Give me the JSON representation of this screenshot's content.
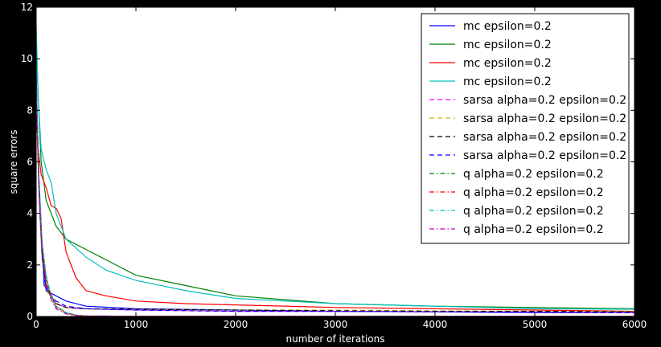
{
  "chart_data": {
    "type": "line",
    "title": "",
    "xlabel": "number of iterations",
    "ylabel": "square errors",
    "xlim": [
      0,
      6000
    ],
    "ylim": [
      0,
      12
    ],
    "xticks": [
      0,
      1000,
      2000,
      3000,
      4000,
      5000,
      6000
    ],
    "yticks": [
      0,
      2,
      4,
      6,
      8,
      10,
      12
    ],
    "grid": false,
    "legend_position": "top-right",
    "series": [
      {
        "name": "mc epsilon=0.2",
        "color": "#0000ff",
        "style": "solid",
        "x": [
          0,
          20,
          50,
          80,
          150,
          300,
          500,
          1000,
          2000,
          3000,
          4000,
          5000,
          6000
        ],
        "y": [
          9.5,
          6.0,
          3.5,
          1.2,
          0.9,
          0.6,
          0.4,
          0.3,
          0.25,
          0.2,
          0.18,
          0.15,
          0.15
        ]
      },
      {
        "name": "mc epsilon=0.2",
        "color": "#008000",
        "style": "solid",
        "x": [
          0,
          20,
          50,
          100,
          200,
          300,
          500,
          700,
          1000,
          1500,
          2000,
          3000,
          4000,
          5000,
          6000
        ],
        "y": [
          10.5,
          8.5,
          6.0,
          4.5,
          3.5,
          3.0,
          2.6,
          2.2,
          1.6,
          1.2,
          0.8,
          0.5,
          0.4,
          0.35,
          0.3
        ]
      },
      {
        "name": "mc epsilon=0.2",
        "color": "#ff0000",
        "style": "solid",
        "x": [
          0,
          20,
          50,
          100,
          150,
          200,
          250,
          300,
          400,
          500,
          700,
          1000,
          1500,
          2000,
          3000,
          4000,
          5000,
          6000
        ],
        "y": [
          9.0,
          6.5,
          5.5,
          5.0,
          4.3,
          4.2,
          3.8,
          2.5,
          1.5,
          1.0,
          0.8,
          0.6,
          0.5,
          0.45,
          0.35,
          0.3,
          0.25,
          0.2
        ]
      },
      {
        "name": "mc epsilon=0.2",
        "color": "#00bfbf",
        "style": "solid",
        "x": [
          0,
          20,
          50,
          100,
          150,
          200,
          300,
          500,
          700,
          1000,
          1500,
          2000,
          3000,
          4000,
          5000,
          6000
        ],
        "y": [
          11.3,
          8.5,
          6.5,
          5.7,
          5.2,
          4.0,
          3.0,
          2.3,
          1.8,
          1.4,
          1.0,
          0.7,
          0.5,
          0.4,
          0.3,
          0.28
        ]
      },
      {
        "name": "sarsa alpha=0.2 epsilon=0.2",
        "color": "#ff00ff",
        "style": "dashed",
        "x": [
          0,
          30,
          60,
          100,
          200,
          300,
          500,
          1000,
          2000,
          3000,
          4000,
          5000,
          6000
        ],
        "y": [
          9.0,
          5.0,
          2.5,
          1.2,
          0.5,
          0.35,
          0.3,
          0.25,
          0.2,
          0.2,
          0.18,
          0.18,
          0.15
        ]
      },
      {
        "name": "sarsa alpha=0.2 epsilon=0.2",
        "color": "#bfbf00",
        "style": "dashed",
        "x": [
          0,
          30,
          60,
          100,
          200,
          300,
          500,
          1000,
          2000,
          3000,
          4000,
          5000,
          6000
        ],
        "y": [
          8.5,
          4.5,
          2.2,
          1.0,
          0.5,
          0.35,
          0.3,
          0.28,
          0.25,
          0.25,
          0.22,
          0.2,
          0.2
        ]
      },
      {
        "name": "sarsa alpha=0.2 epsilon=0.2",
        "color": "#000000",
        "style": "dashed",
        "x": [
          0,
          30,
          60,
          100,
          200,
          300,
          500,
          1000,
          2000,
          3000,
          4000,
          5000,
          6000
        ],
        "y": [
          8.8,
          4.8,
          2.4,
          1.1,
          0.5,
          0.35,
          0.3,
          0.28,
          0.25,
          0.22,
          0.2,
          0.2,
          0.18
        ]
      },
      {
        "name": "sarsa alpha=0.2 epsilon=0.2",
        "color": "#0000ff",
        "style": "dashed",
        "x": [
          0,
          30,
          60,
          100,
          200,
          300,
          500,
          1000,
          2000,
          3000,
          4000,
          5000,
          6000
        ],
        "y": [
          8.6,
          4.6,
          2.3,
          1.0,
          0.6,
          0.4,
          0.3,
          0.25,
          0.2,
          0.2,
          0.18,
          0.16,
          0.15
        ]
      },
      {
        "name": "q alpha=0.2 epsilon=0.2",
        "color": "#008000",
        "style": "dashdot",
        "x": [
          0,
          30,
          60,
          100,
          150,
          200,
          300,
          400,
          500,
          1000,
          2000,
          3000,
          4000,
          5000,
          6000
        ],
        "y": [
          9.0,
          5.0,
          2.8,
          1.5,
          0.8,
          0.4,
          0.15,
          0.05,
          0.02,
          0.01,
          0.01,
          0.01,
          0.01,
          0.01,
          0.01
        ]
      },
      {
        "name": "q alpha=0.2 epsilon=0.2",
        "color": "#ff0000",
        "style": "dashdot",
        "x": [
          0,
          30,
          60,
          100,
          150,
          200,
          300,
          400,
          500,
          1000,
          2000,
          3000,
          4000,
          5000,
          6000
        ],
        "y": [
          8.8,
          4.8,
          2.6,
          1.4,
          0.7,
          0.35,
          0.12,
          0.04,
          0.02,
          0.01,
          0.01,
          0.01,
          0.01,
          0.01,
          0.01
        ]
      },
      {
        "name": "q alpha=0.2 epsilon=0.2",
        "color": "#00bfbf",
        "style": "dashdot",
        "x": [
          0,
          30,
          60,
          100,
          150,
          200,
          300,
          400,
          500,
          1000,
          2000,
          3000,
          4000,
          5000,
          6000
        ],
        "y": [
          9.2,
          5.2,
          2.9,
          1.6,
          0.8,
          0.4,
          0.15,
          0.05,
          0.02,
          0.01,
          0.01,
          0.01,
          0.01,
          0.01,
          0.01
        ]
      },
      {
        "name": "q alpha=0.2 epsilon=0.2",
        "color": "#bf00bf",
        "style": "dashdot",
        "x": [
          0,
          30,
          60,
          100,
          150,
          200,
          300,
          400,
          500,
          1000,
          2000,
          3000,
          4000,
          5000,
          6000
        ],
        "y": [
          8.7,
          4.7,
          2.5,
          1.3,
          0.65,
          0.3,
          0.1,
          0.04,
          0.02,
          0.01,
          0.01,
          0.01,
          0.01,
          0.01,
          0.01
        ]
      }
    ]
  }
}
